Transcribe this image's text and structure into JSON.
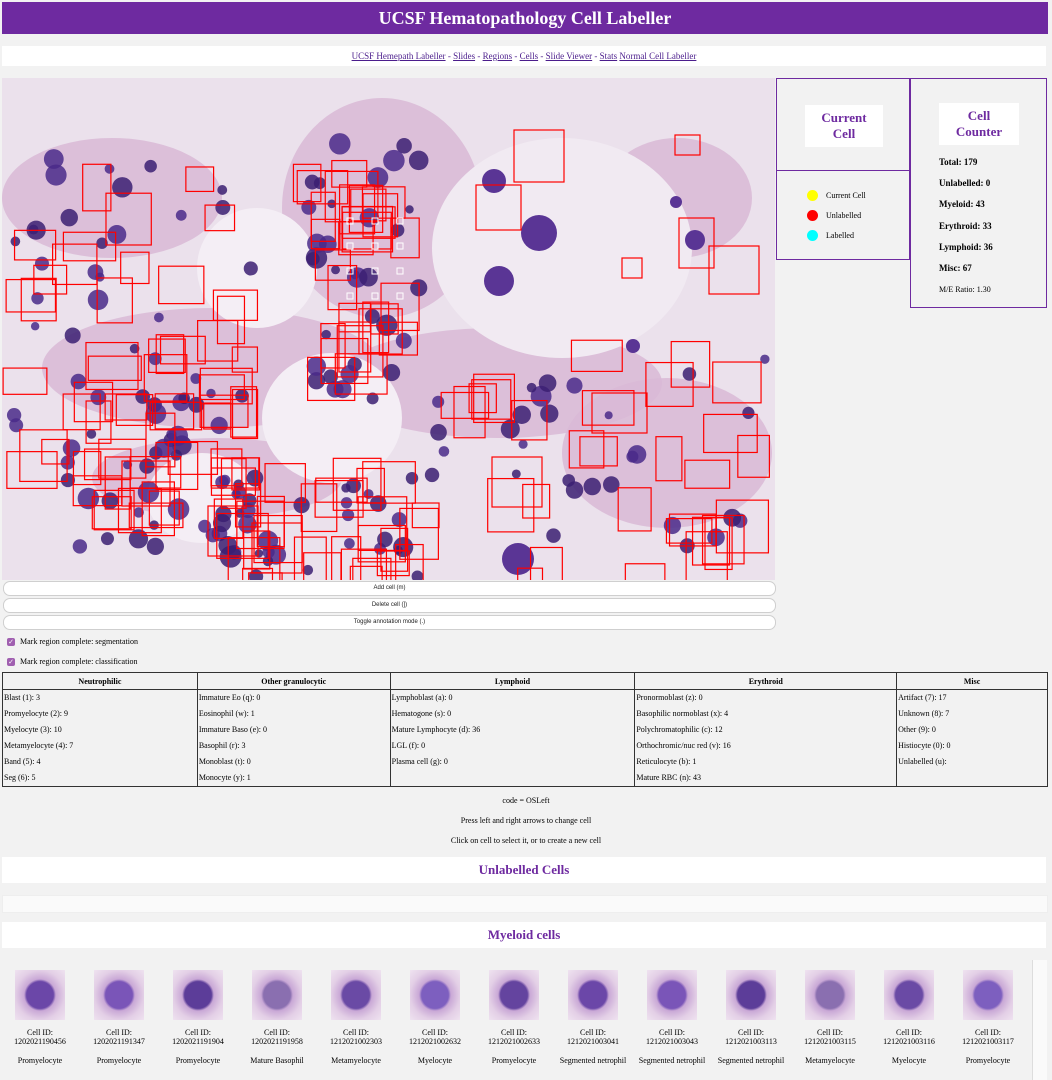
{
  "header": {
    "title": "UCSF Hematopathology Cell Labeller"
  },
  "nav": [
    {
      "label": "UCSF Hemepath Labeller"
    },
    {
      "label": "Slides"
    },
    {
      "label": "Regions"
    },
    {
      "label": "Cells"
    },
    {
      "label": "Slide Viewer"
    },
    {
      "label": "Stats"
    },
    {
      "label": "Normal Cell Labeller"
    }
  ],
  "nav_separator": " - ",
  "buttons": {
    "add_cell": "Add cell (m)",
    "delete_cell": "Delete cell (])",
    "toggle_annotation": "Toggle annotation mode (.)"
  },
  "current_cell": {
    "title_line1": "Current",
    "title_line2": "Cell",
    "legend": [
      {
        "label": "Current Cell",
        "color": "#ffff00"
      },
      {
        "label": "Unlabelled",
        "color": "#ff0000"
      },
      {
        "label": "Labelled",
        "color": "#00ffff"
      }
    ]
  },
  "counter": {
    "title_line1": "Cell",
    "title_line2": "Counter",
    "total": "Total: 179",
    "unlabelled": "Unlabelled: 0",
    "myeloid": "Myeloid: 43",
    "erythroid": "Erythroid: 33",
    "lymphoid": "Lymphoid: 36",
    "misc": "Misc: 67",
    "me_ratio": "M/E Ratio: 1.30"
  },
  "checkboxes": {
    "segmentation": "Mark region complete: segmentation",
    "classification": "Mark region complete: classification"
  },
  "table": {
    "headers": [
      "Neutrophilic",
      "Other granulocytic",
      "Lymphoid",
      "Erythroid",
      "Misc"
    ],
    "columns": [
      [
        "Blast (1): 3",
        "Promyelocyte (2): 9",
        "Myelocyte (3): 10",
        "Metamyelocyte (4): 7",
        "Band (5): 4",
        "Seg (6): 5"
      ],
      [
        "Immature Eo (q): 0",
        "Eosinophil (w): 1",
        "Immature Baso (e): 0",
        "Basophil (r): 3",
        "Monoblast (t): 0",
        "Monocyte (y): 1"
      ],
      [
        "Lymphoblast (a): 0",
        "Hematogone (s): 0",
        "Mature Lymphocyte (d): 36",
        "LGL (f): 0",
        "Plasma cell (g): 0",
        ""
      ],
      [
        "Pronormoblast (z): 0",
        "Basophilic normoblast (x): 4",
        "Polychromatophilic (c): 12",
        "Orthochromic/nuc red (v): 16",
        "Reticulocyte (b): 1",
        "Mature RBC (n): 43"
      ],
      [
        "Artifact (7): 17",
        "Unknown (8): 7",
        "Other (9): 0",
        "Histiocyte (0): 0",
        "Unlabelled (u):",
        ""
      ]
    ]
  },
  "info": {
    "code": "code = OSLeft",
    "arrows": "Press left and right arrows to change cell",
    "click": "Click on cell to select it, or to create a new cell"
  },
  "sections": {
    "unlabelled": "Unlabelled Cells",
    "myeloid": "Myeloid cells"
  },
  "myeloid_cells": [
    {
      "id_label": "Cell ID:",
      "id": "1202021190456",
      "type": "Promyelocyte"
    },
    {
      "id_label": "Cell ID:",
      "id": "1202021191347",
      "type": "Promyelocyte"
    },
    {
      "id_label": "Cell ID:",
      "id": "1202021191904",
      "type": "Promyelocyte"
    },
    {
      "id_label": "Cell ID:",
      "id": "1202021191958",
      "type": "Mature Basophil"
    },
    {
      "id_label": "Cell ID:",
      "id": "1212021002303",
      "type": "Metamyelocyte"
    },
    {
      "id_label": "Cell ID:",
      "id": "1212021002632",
      "type": "Myelocyte"
    },
    {
      "id_label": "Cell ID:",
      "id": "1212021002633",
      "type": "Promyelocyte"
    },
    {
      "id_label": "Cell ID:",
      "id": "1212021003041",
      "type": "Segmented netrophil"
    },
    {
      "id_label": "Cell ID:",
      "id": "1212021003043",
      "type": "Segmented netrophil"
    },
    {
      "id_label": "Cell ID:",
      "id": "1212021003113",
      "type": "Segmented netrophil"
    },
    {
      "id_label": "Cell ID:",
      "id": "1212021003115",
      "type": "Metamyelocyte"
    },
    {
      "id_label": "Cell ID:",
      "id": "1212021003116",
      "type": "Myelocyte"
    },
    {
      "id_label": "Cell ID:",
      "id": "1212021003117",
      "type": "Promyelocyte"
    }
  ],
  "colors": {
    "accent": "#6e2aa0",
    "box": "#ff0000",
    "stain": "#4a2a8a"
  }
}
